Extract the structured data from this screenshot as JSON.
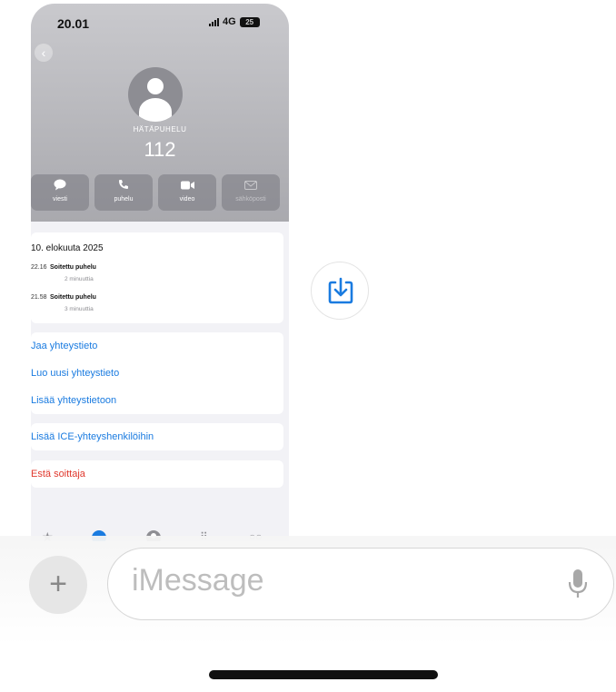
{
  "status_bar": {
    "time": "20.01",
    "network": "4G",
    "battery": "25"
  },
  "contact": {
    "label": "HÄTÄPUHELU",
    "number": "112"
  },
  "actions": [
    {
      "label": "viesti",
      "icon": "message-bubble-icon"
    },
    {
      "label": "puhelu",
      "icon": "phone-icon"
    },
    {
      "label": "video",
      "icon": "video-camera-icon"
    },
    {
      "label": "sähköposti",
      "icon": "mail-icon"
    }
  ],
  "recents": {
    "date": "10. elokuuta 2025",
    "calls": [
      {
        "time": "22.16",
        "type": "Soitettu puhelu",
        "duration": "2 minuuttia"
      },
      {
        "time": "21.58",
        "type": "Soitettu puhelu",
        "duration": "3 minuuttia"
      }
    ]
  },
  "links": {
    "share": "Jaa yhteystieto",
    "new_contact": "Luo uusi yhteystieto",
    "add_existing": "Lisää yhteystietoon",
    "add_ice": "Lisää ICE-yhteyshenkilöihin",
    "block": "Estä soittaja"
  },
  "tab_bar": [
    "favorites-icon",
    "recents-icon",
    "contacts-icon",
    "keypad-icon",
    "voicemail-icon"
  ],
  "compose": {
    "placeholder": "iMessage"
  },
  "colors": {
    "link_blue": "#1a7be0",
    "destructive_red": "#e0382d",
    "header_gray": "#b5b5ba"
  }
}
